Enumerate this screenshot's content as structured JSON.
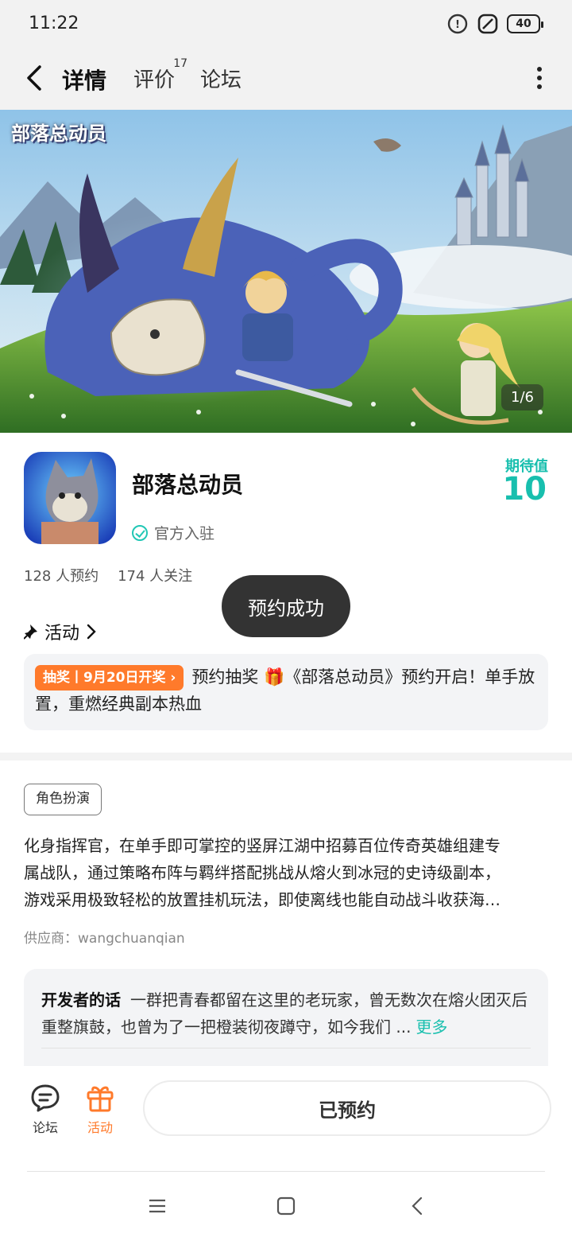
{
  "status": {
    "time": "11:22",
    "battery": "40"
  },
  "nav": {
    "tabs": [
      {
        "label": "详情",
        "active": true
      },
      {
        "label": "评价",
        "badge": "17"
      },
      {
        "label": "论坛"
      }
    ]
  },
  "banner": {
    "brand": "部落总动员",
    "pager": "1/6"
  },
  "app": {
    "name": "部落总动员",
    "official": "官方入驻",
    "expect_label": "期待值",
    "expect_value": "10",
    "reservations": "128 人预约",
    "followers": "174 人关注"
  },
  "toast": "预约成功",
  "activity": {
    "title": "活动",
    "badge": "抽奖丨9月20日开奖",
    "text": "预约抽奖 🎁《部落总动员》预约开启！单手放置，重燃经典副本热血"
  },
  "details": {
    "tag": "角色扮演",
    "desc_line1": "化身指挥官，在单手即可掌控的竖屏江湖中招募百位传奇英雄组建专",
    "desc_line2": "属战队，通过策略布阵与羁绊搭配挑战从熔火到冰冠的史诗级副本，",
    "desc_line3": "游戏采用极致轻松的放置挂机玩法，即使离线也能自动战斗收获海…",
    "supplier": "供应商：wangchuanqian"
  },
  "developer": {
    "label": "开发者的话",
    "text": "一群把青春都留在这里的老玩家，曾无数次在熔火团灭后重整旗鼓，也曾为了一把橙装彻夜蹲守，如今我们 ...",
    "more": "更多"
  },
  "bottom": {
    "forum": "论坛",
    "activity": "活动",
    "reserve_button": "已预约"
  },
  "colors": {
    "accent": "#18bfae",
    "orange": "#ff7a2b"
  }
}
